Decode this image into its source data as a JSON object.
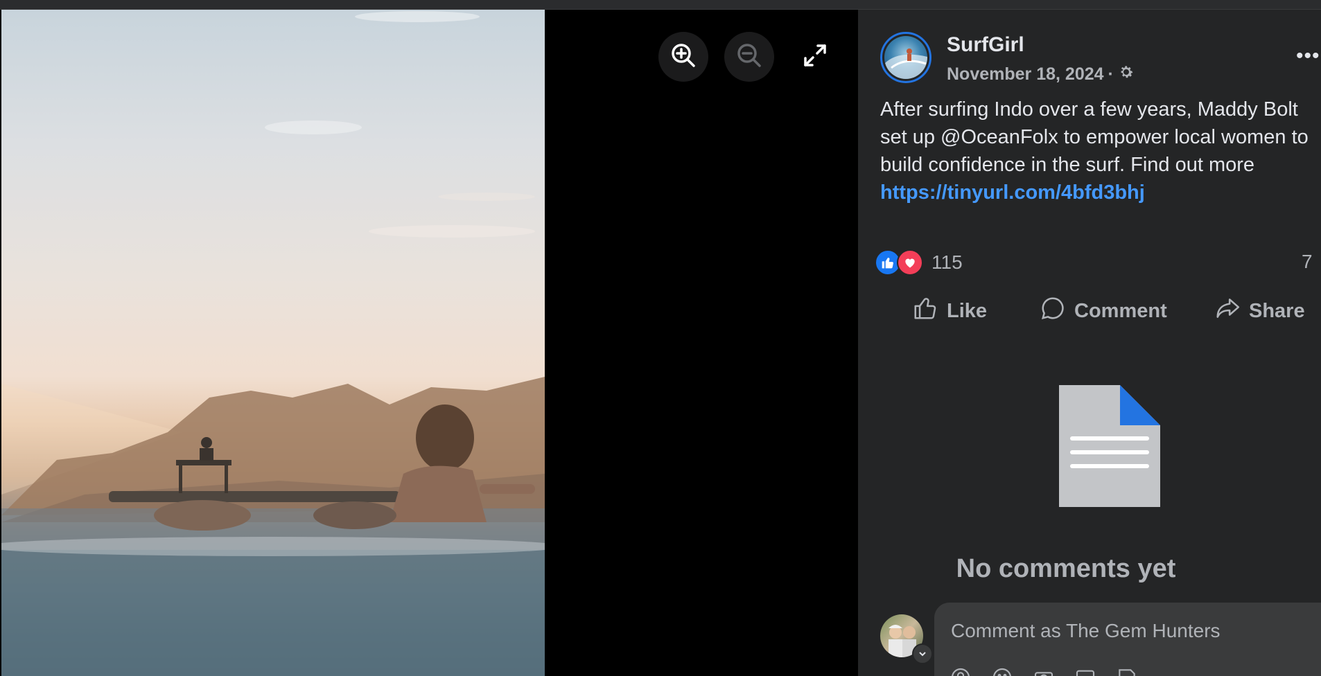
{
  "post": {
    "author": "SurfGirl",
    "date": "November 18, 2024",
    "separator": "·",
    "more_label": "•••",
    "text_lines": [
      "After surfing Indo over a few years, Maddy Bolt",
      "set up @OceanFolx to empower local women to",
      "build confidence in the surf. Find out more"
    ],
    "link": "https://tinyurl.com/4bfd3bhj"
  },
  "reactions": {
    "count": "115",
    "comment_count": "7"
  },
  "actions": {
    "like": "Like",
    "comment": "Comment",
    "share": "Share"
  },
  "comments": {
    "empty_text": "No comments yet",
    "placeholder": "Comment as The Gem Hunters"
  },
  "viewer_icons": [
    "zoom-in-icon",
    "zoom-out-icon",
    "fullscreen-icon"
  ],
  "colors": {
    "accent": "#2374e1",
    "link": "#4599ff",
    "panel_bg": "#242526",
    "like": "#1877f2",
    "love": "#f33e58"
  }
}
